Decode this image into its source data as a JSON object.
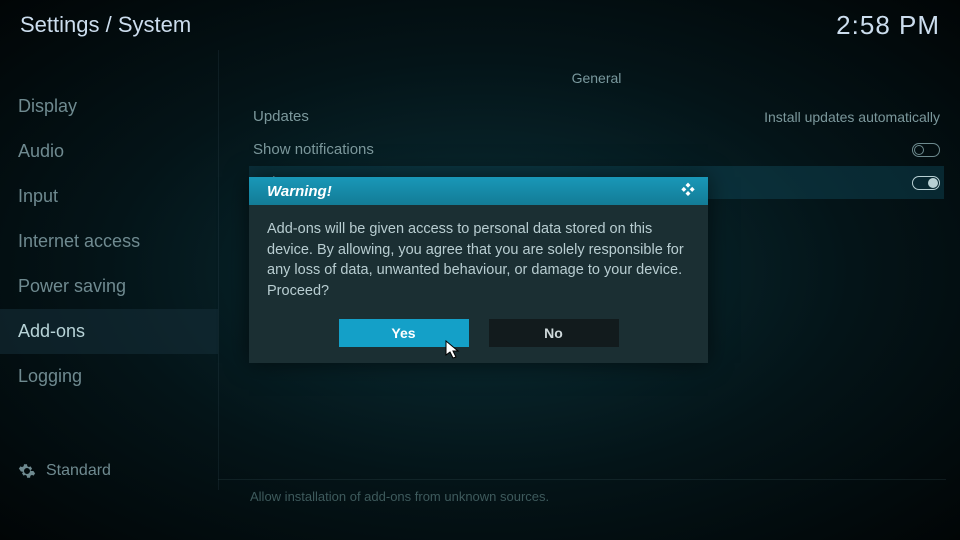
{
  "header": {
    "breadcrumb": "Settings / System",
    "clock": "2:58 PM"
  },
  "sidebar": {
    "items": [
      {
        "label": "Display"
      },
      {
        "label": "Audio"
      },
      {
        "label": "Input"
      },
      {
        "label": "Internet access"
      },
      {
        "label": "Power saving"
      },
      {
        "label": "Add-ons"
      },
      {
        "label": "Logging"
      }
    ],
    "profile_label": "Standard"
  },
  "content": {
    "section_title": "General",
    "settings": [
      {
        "label": "Updates",
        "value": "Install updates automatically"
      },
      {
        "label": "Show notifications",
        "toggle": "off"
      },
      {
        "label": "Unknown sources",
        "toggle": "on"
      }
    ],
    "hint": "Allow installation of add-ons from unknown sources."
  },
  "dialog": {
    "title": "Warning!",
    "body": "Add-ons will be given access to personal data stored on this device. By allowing, you agree that you are solely responsible for any loss of data, unwanted behaviour, or damage to your device. Proceed?",
    "yes_label": "Yes",
    "no_label": "No"
  }
}
